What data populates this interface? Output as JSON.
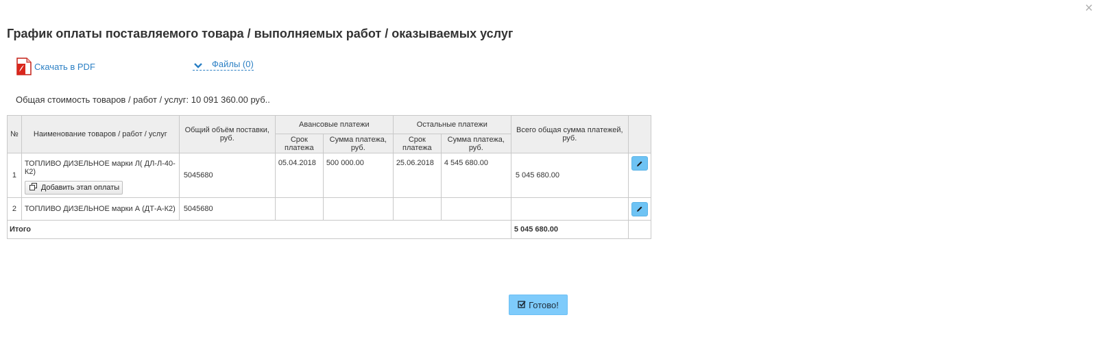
{
  "dialog": {
    "close_glyph": "×",
    "title": "График оплаты поставляемого товара / выполняемых работ / оказываемых услуг"
  },
  "actions": {
    "pdf_label": "Скачать в PDF",
    "files_label": "Файлы (0)"
  },
  "total_cost_text": "Общая стоимость товаров / работ / услуг: 10 091 360.00 руб..",
  "table": {
    "headers": {
      "num": "№",
      "name": "Наименование товаров / работ / услуг",
      "volume": "Общий объём поставки, руб.",
      "advance_group": "Авансовые платежи",
      "other_group": "Остальные платежи",
      "total": "Всего общая сумма платежей, руб.",
      "due_date": "Срок платежа",
      "pay_sum": "Сумма платежа, руб."
    },
    "rows": [
      {
        "num": "1",
        "name": "ТОПЛИВО ДИЗЕЛЬНОЕ марки Л( ДЛ-Л-40-К2)",
        "volume": "5045680",
        "adv_date": "05.04.2018",
        "adv_sum": "500 000.00",
        "oth_date": "25.06.2018",
        "oth_sum": "4 545 680.00",
        "total": "5 045 680.00",
        "add_stage_label": "Добавить этап оплаты"
      },
      {
        "num": "2",
        "name": "ТОПЛИВО ДИЗЕЛЬНОЕ марки А (ДТ-А-К2)",
        "volume": "5045680",
        "adv_date": "",
        "adv_sum": "",
        "oth_date": "",
        "oth_sum": "",
        "total": ""
      }
    ],
    "footer": {
      "label": "Итого",
      "total": "5 045 680.00"
    }
  },
  "done_label": "Готово!",
  "colors": {
    "link": "#2a7fc4",
    "primary_button": "#7ecbfb",
    "edit_button": "#6ec3f4",
    "header_bg": "#eeeeee",
    "pdf_icon": "#d9261c"
  },
  "icons": {
    "pdf": "pdf-file-icon",
    "files_toggle": "chevron-down-icon",
    "add_stage": "copy-icon",
    "edit": "pencil-icon",
    "done": "check-square-icon",
    "close": "close-icon"
  }
}
